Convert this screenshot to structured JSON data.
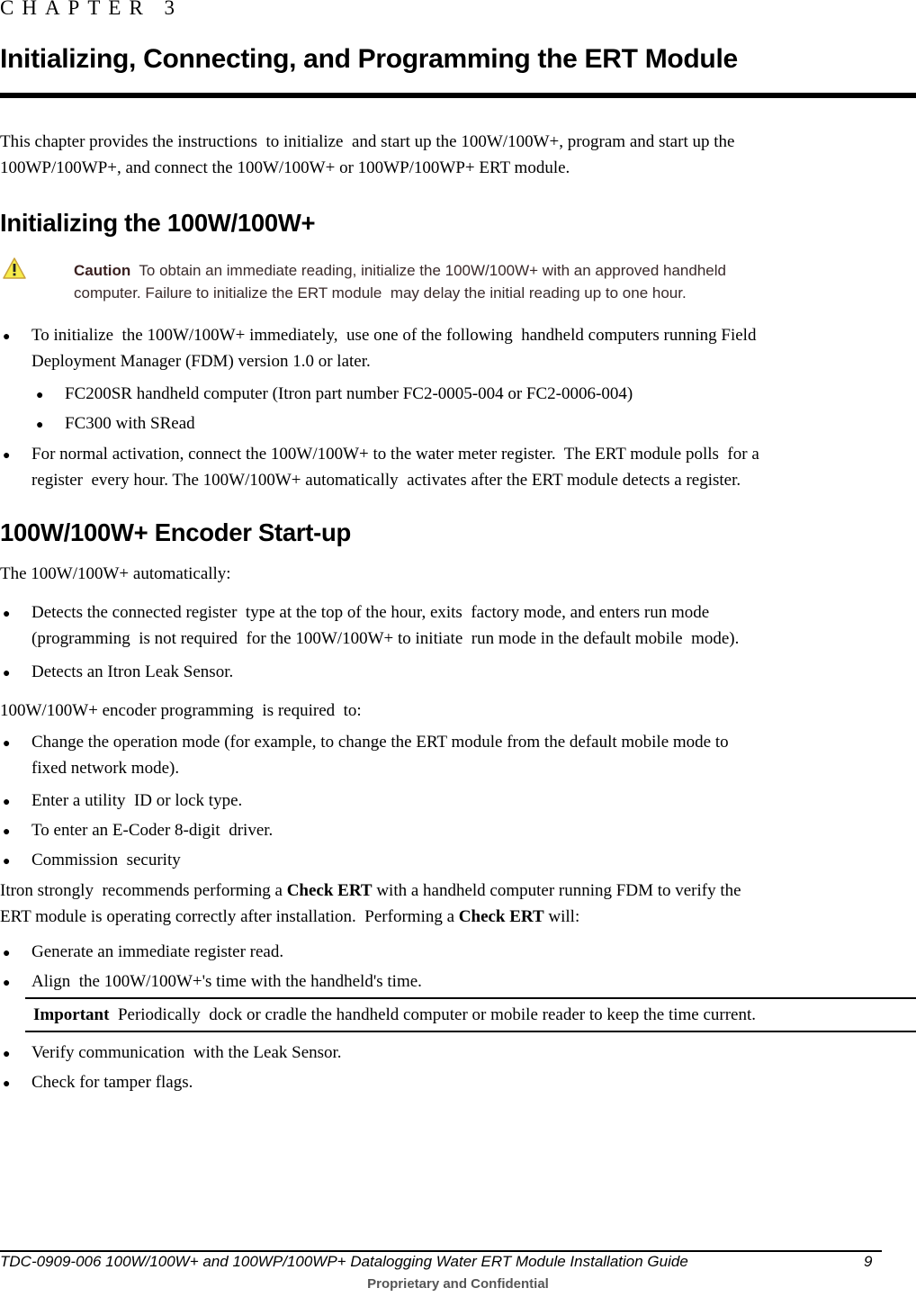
{
  "chapter": {
    "label": "CHAPTER 3",
    "title": "Initializing, Connecting, and Programming the ERT Module"
  },
  "intro": {
    "line1": "This chapter provides the instructions  to initialize  and start up the 100W/100W+, program and start up the",
    "line2": "100WP/100WP+, and connect the 100W/100W+ or 100WP/100WP+ ERT module."
  },
  "section1": {
    "heading": "Initializing the 100W/100W+",
    "caution": {
      "icon": "warning-triangle-icon",
      "label": "Caution",
      "line1": "  To obtain an immediate reading, initialize the 100W/100W+ with an approved handheld",
      "line2": "computer. Failure to initialize the ERT module  may delay the initial reading up to one hour."
    },
    "bullets": [
      {
        "line1": "To initialize  the 100W/100W+ immediately,  use one of the following  handheld computers running Field",
        "line2": "Deployment Manager (FDM) version 1.0 or later.",
        "subitems": [
          "FC200SR handheld computer (Itron part number FC2-0005-004 or FC2-0006-004)",
          "FC300 with SRead"
        ]
      },
      {
        "line1": "For normal activation, connect the 100W/100W+ to the water meter register.  The ERT module polls  for a",
        "line2": "register  every hour. The 100W/100W+ automatically  activates after the ERT module detects a register."
      }
    ]
  },
  "section2": {
    "heading": "100W/100W+ Encoder Start-up",
    "intro": "The 100W/100W+ automatically:",
    "auto_items": [
      {
        "line1": "Detects the connected register  type at the top of the hour, exits  factory mode, and enters run mode",
        "line2": "(programming  is not required  for the 100W/100W+ to initiate  run mode in the default mobile  mode)."
      },
      {
        "line1": "Detects an Itron Leak Sensor."
      }
    ],
    "programming_intro": "100W/100W+ encoder programming  is required  to:",
    "programming_items": [
      {
        "line1": "Change the operation mode (for example, to change the ERT module from the default mobile mode to",
        "line2": "fixed network mode)."
      },
      {
        "line1": "Enter a utility  ID or lock type."
      },
      {
        "line1": "To enter an E-Coder 8-digit  driver."
      },
      {
        "line1": "Commission  security"
      }
    ],
    "check_para": {
      "l1_a": "Itron strongly  recommends performing a ",
      "l1_bold": "Check ERT",
      "l1_b": " with a handheld computer running FDM to verify the",
      "l2_a": "ERT module is operating correctly after installation.  Performing a ",
      "l2_bold": "Check ERT",
      "l2_b": " will:"
    },
    "check_items": [
      "Generate an immediate register read.",
      "Align  the 100W/100W+'s time with the handheld's time."
    ],
    "important": {
      "label": "Important",
      "text": "  Periodically  dock or cradle the handheld computer or mobile reader to keep the time current."
    },
    "check_items_after": [
      "Verify communication  with the Leak Sensor.",
      "Check for tamper flags."
    ]
  },
  "footer": {
    "doc_title": "TDC-0909-006 100W/100W+ and 100WP/100WP+ Datalogging Water ERT Module Installation Guide",
    "page_number": "9",
    "confidential": "Proprietary and Confidential"
  }
}
